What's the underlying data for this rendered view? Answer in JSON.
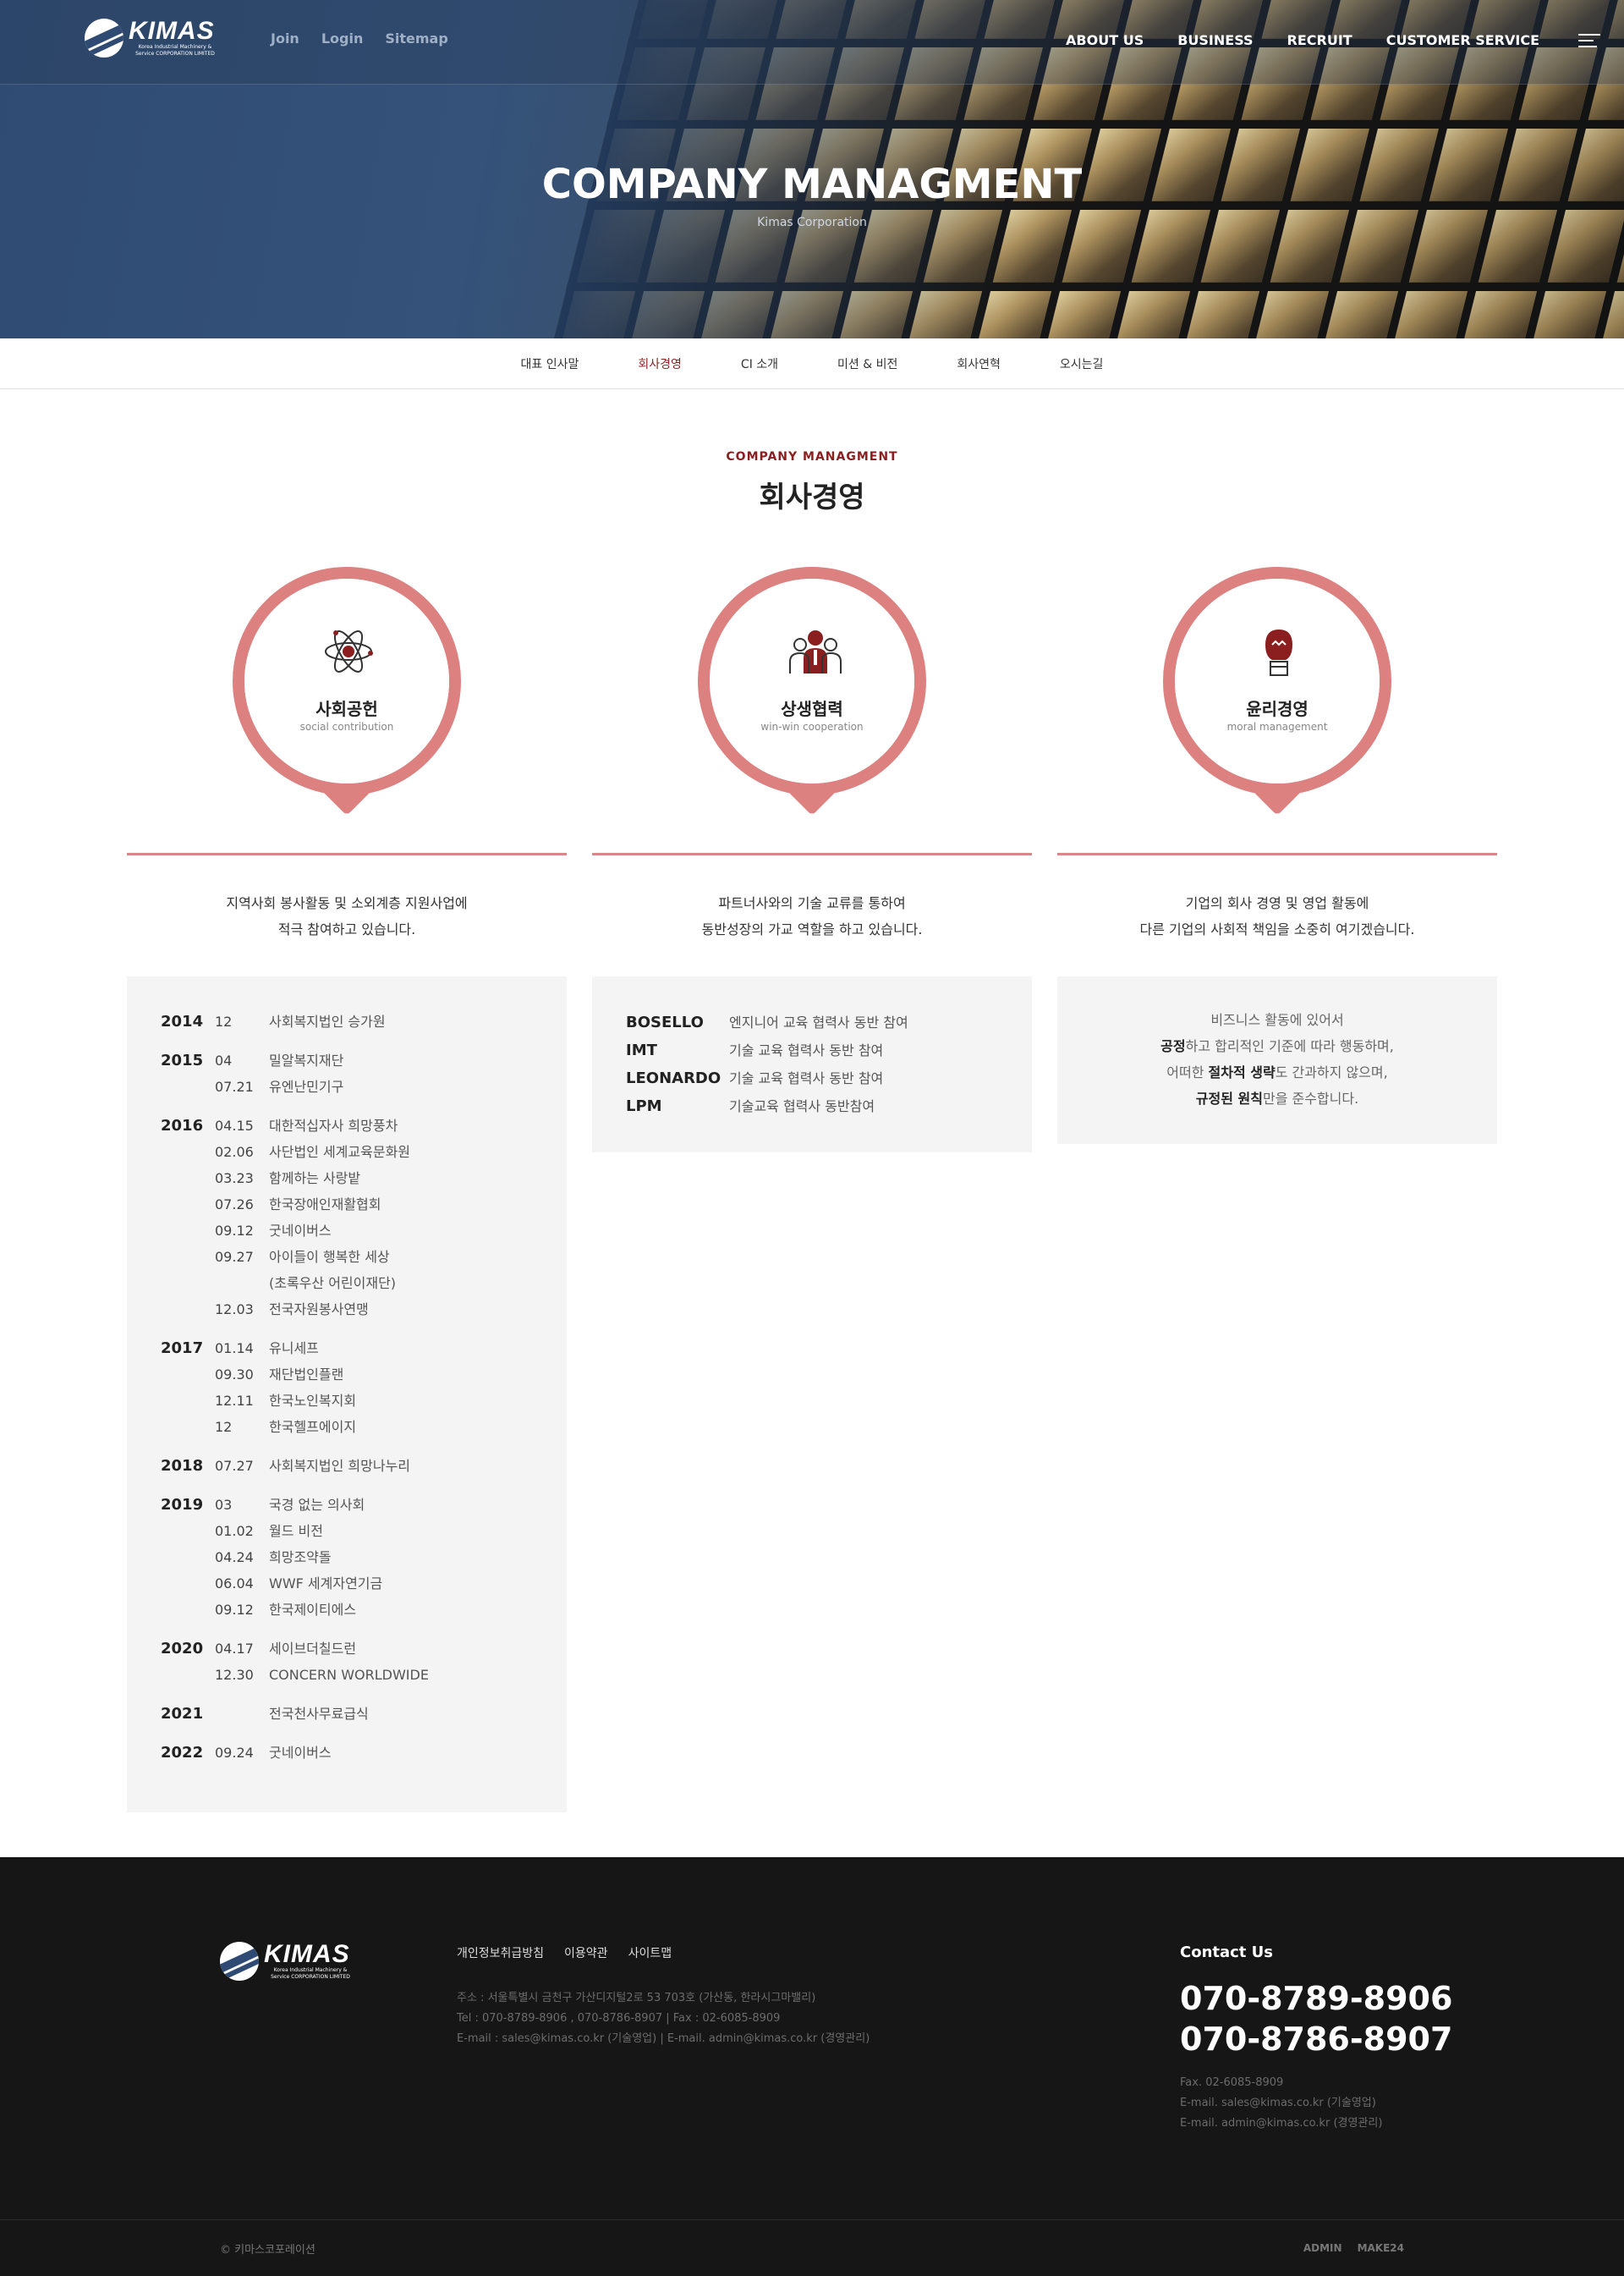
{
  "header": {
    "logo_text": "KIMAS",
    "logo_sub": "Korea Industrial Machinery & Service CORPORATION LIMITED",
    "top_links": [
      "Join",
      "Login",
      "Sitemap"
    ],
    "main_nav": [
      "ABOUT US",
      "BUSINESS",
      "RECRUIT",
      "CUSTOMER SERVICE"
    ]
  },
  "hero": {
    "title": "COMPANY MANAGMENT",
    "subtitle": "Kimas Corporation"
  },
  "subnav": {
    "items": [
      "대표 인사말",
      "회사경영",
      "CI 소개",
      "미션 & 비전",
      "회사연혁",
      "오시는길"
    ],
    "active": "회사경영"
  },
  "section": {
    "eyebrow": "COMPANY MANAGMENT",
    "title": "회사경영"
  },
  "cards": [
    {
      "icon": "atom-icon",
      "title": "사회공헌",
      "subtitle": "social contribution",
      "desc_1": "지역사회 봉사활동 및 소외계층 지원사업에",
      "desc_2": "적극 참여하고 있습니다."
    },
    {
      "icon": "people-icon",
      "title": "상생협력",
      "subtitle": "win-win cooperation",
      "desc_1": "파트너사와의 기술 교류를 통하여",
      "desc_2": "동반성장의 가교 역할을 하고 있습니다."
    },
    {
      "icon": "boxing-glove-icon",
      "title": "윤리경영",
      "subtitle": "moral management",
      "desc_1": "기업의 회사 경영 및 영업 활동에",
      "desc_2": "다른 기업의 사회적 책임을 소중히 여기겠습니다."
    }
  ],
  "timeline": [
    {
      "year": "2014",
      "rows": [
        {
          "date": "12",
          "event": "사회복지법인 승가원"
        }
      ]
    },
    {
      "year": "2015",
      "rows": [
        {
          "date": "04",
          "event": "밀알복지재단"
        },
        {
          "date": "07.21",
          "event": "유엔난민기구"
        }
      ]
    },
    {
      "year": "2016",
      "rows": [
        {
          "date": "04.15",
          "event": "대한적십자사 희망풍차"
        },
        {
          "date": "02.06",
          "event": "사단법인 세계교육문화원"
        },
        {
          "date": "03.23",
          "event": "함께하는 사랑밭"
        },
        {
          "date": "07.26",
          "event": "한국장애인재활협회"
        },
        {
          "date": "09.12",
          "event": "굿네이버스"
        },
        {
          "date": "09.27",
          "event": "아이들이 행복한 세상"
        },
        {
          "date": "",
          "event": "(초록우산 어린이재단)"
        },
        {
          "date": "12.03",
          "event": "전국자원봉사연맹"
        }
      ]
    },
    {
      "year": "2017",
      "rows": [
        {
          "date": "01.14",
          "event": "유니세프"
        },
        {
          "date": "09.30",
          "event": "재단법인플랜"
        },
        {
          "date": "12.11",
          "event": "한국노인복지회"
        },
        {
          "date": "12",
          "event": "한국헬프에이지"
        }
      ]
    },
    {
      "year": "2018",
      "rows": [
        {
          "date": "07.27",
          "event": "사회복지법인 희망나누리"
        }
      ]
    },
    {
      "year": "2019",
      "rows": [
        {
          "date": "03",
          "event": "국경 없는 의사회"
        },
        {
          "date": "01.02",
          "event": "월드 비전"
        },
        {
          "date": "04.24",
          "event": "희망조약돌"
        },
        {
          "date": "06.04",
          "event": "WWF 세계자연기금"
        },
        {
          "date": "09.12",
          "event": "한국제이티에스"
        }
      ]
    },
    {
      "year": "2020",
      "rows": [
        {
          "date": "04.17",
          "event": "세이브더칠드런"
        },
        {
          "date": "12.30",
          "event": "CONCERN WORLDWIDE"
        }
      ]
    },
    {
      "year": "2021",
      "rows": [
        {
          "date": "",
          "event": "전국천사무료급식"
        }
      ]
    },
    {
      "year": "2022",
      "rows": [
        {
          "date": "09.24",
          "event": "굿네이버스"
        }
      ]
    }
  ],
  "partners": [
    {
      "name": "BOSELLO",
      "desc": "엔지니어 교육 협력사 동반 참여"
    },
    {
      "name": "IMT",
      "desc": "기술 교육 협력사 동반 참여"
    },
    {
      "name": "LEONARDO",
      "desc": "기술 교육 협력사 동반 참여"
    },
    {
      "name": "LPM",
      "desc": "기술교육 협력사 동반참여"
    }
  ],
  "ethics": {
    "l1": "비즈니스 활동에 있어서",
    "l2_b": "공정",
    "l2_r": "하고 합리적인 기준에 따라 행동하며,",
    "l3_a": "어떠한 ",
    "l3_b": "절차적 생략",
    "l3_c": "도 간과하지 않으며,",
    "l4_b": "규정된 원칙",
    "l4_r": "만을 준수합니다."
  },
  "footer": {
    "links": [
      "개인정보취급방침",
      "이용약관",
      "사이트맵"
    ],
    "address": "주소 : 서울특별시 금천구 가산디지털2로 53 703호 (가산동, 한라시그마밸리)",
    "tel_line": "Tel : 070-8789-8906 , 070-8786-8907  |  Fax : 02-6085-8909",
    "email_line": "E-mail : sales@kimas.co.kr (기술영업)  |  E-mail. admin@kimas.co.kr (경영관리)",
    "contact_title": "Contact Us",
    "phone_1": "070-8789-8906",
    "phone_2": "070-8786-8907",
    "fax": "Fax. 02-6085-8909",
    "email_1": "E-mail. sales@kimas.co.kr (기술영업)",
    "email_2": "E-mail. admin@kimas.co.kr (경영관리)",
    "copyright": "© 키마스코포레이션",
    "bottom_links": [
      "ADMIN",
      "MAKE24"
    ]
  }
}
